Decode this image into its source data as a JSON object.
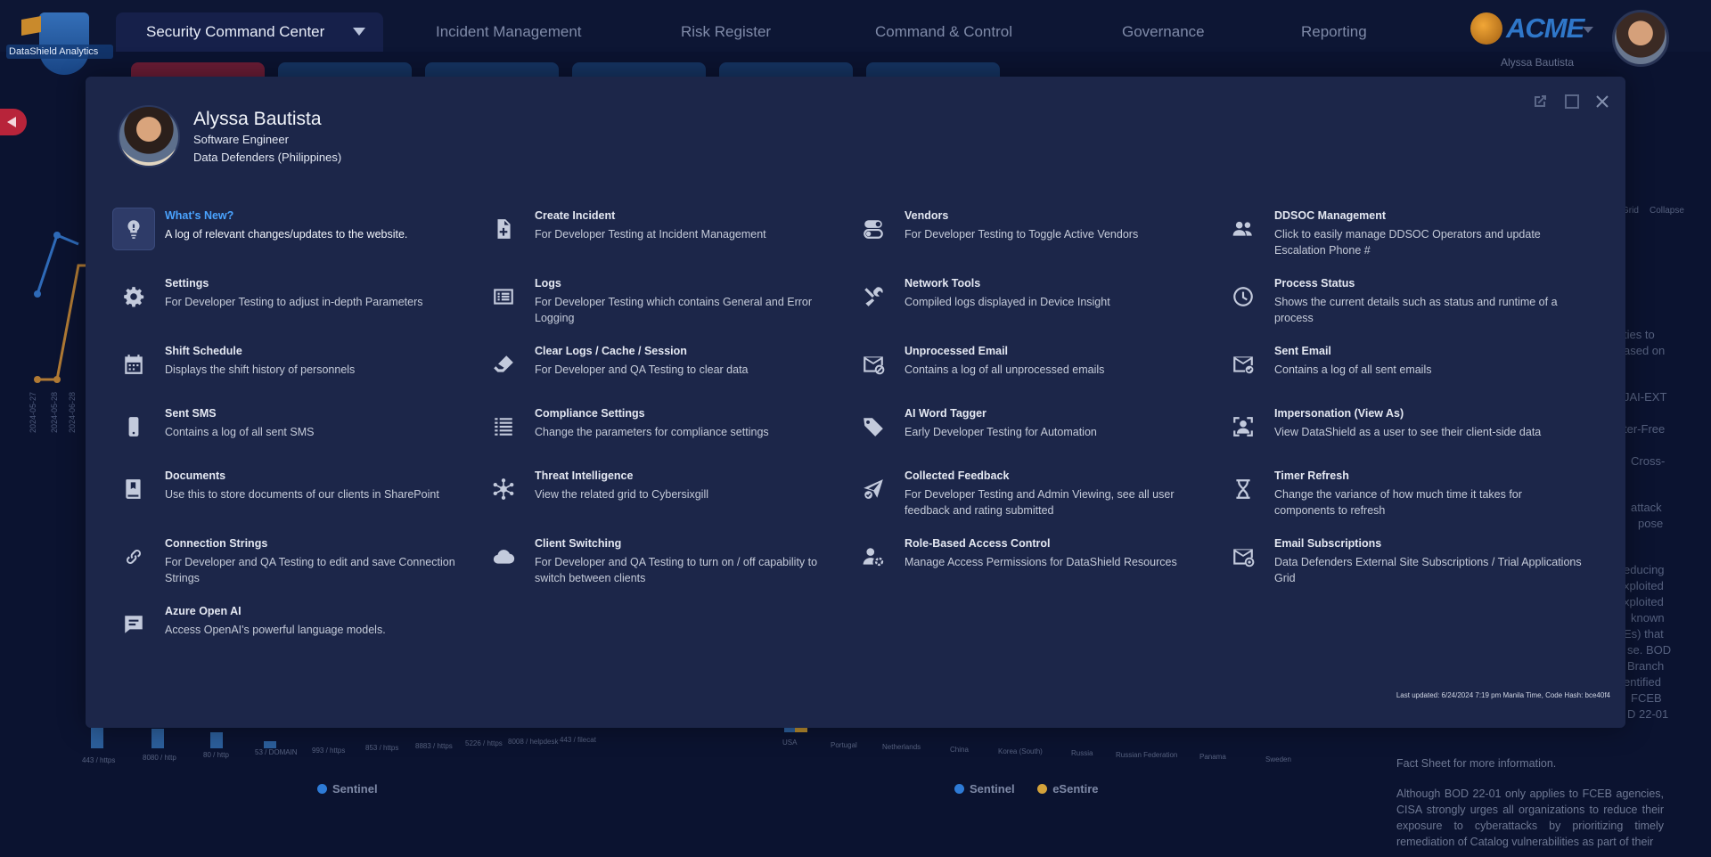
{
  "header": {
    "logo_text": "DataShield Analytics",
    "nav_active": "Security Command Center",
    "nav_items": [
      "Incident Management",
      "Risk Register",
      "Command & Control",
      "Governance",
      "Reporting"
    ],
    "brand": "ACME",
    "user_name": "Alyssa Bautista"
  },
  "background": {
    "dates": [
      "2024-05-27",
      "2024-05-28",
      "2024-06-28"
    ],
    "left_chart_categories": [
      "443 / https",
      "8080 / http",
      "80 / http",
      "53 / DOMAIN",
      "993 / https",
      "853 / https",
      "8883 / https",
      "5226 / https",
      "8008 / helpdesk",
      "443 / filecat"
    ],
    "right_chart_categories": [
      "USA",
      "Portugal",
      "Netherlands",
      "China",
      "Korea (South)",
      "Russia",
      "Russian Federation",
      "Panama",
      "Sweden"
    ],
    "legend_left": [
      "Sentinel"
    ],
    "legend_right": [
      "Sentinel",
      "eSentire"
    ],
    "colors": {
      "sentinel": "#2e7bd6",
      "esentire": "#d4a23a",
      "active_tab": "#b8243a"
    },
    "article_text": "Fact Sheet for more information.",
    "article_para": "Although BOD 22-01 only applies to FCEB agencies, CISA strongly urges all organizations to reduce their exposure to cyberattacks by prioritizing timely remediation of Catalog vulnerabilities as part of their",
    "fragments": [
      "Grid",
      "Collapse",
      "ties to",
      "ased on",
      "JAI-EXT",
      "ter-Free",
      "Cross-",
      "attack",
      "pose",
      "educing",
      "xploited",
      "xploited",
      "known",
      "Es) that",
      "se. BOD",
      "Branch",
      "entified",
      "FCEB",
      "D 22-01"
    ]
  },
  "modal": {
    "profile": {
      "name": "Alyssa Bautista",
      "role": "Software Engineer",
      "org": "Data Defenders (Philippines)"
    },
    "items": [
      {
        "title": "What's New?",
        "desc": "A log of relevant changes/updates to the website.",
        "icon": "lightbulb-icon"
      },
      {
        "title": "Create Incident",
        "desc": "For Developer Testing at Incident Management",
        "icon": "file-plus-icon"
      },
      {
        "title": "Vendors",
        "desc": "For Developer Testing to Toggle Active Vendors",
        "icon": "toggle-icon"
      },
      {
        "title": "DDSOC Management",
        "desc": "Click to easily manage DDSOC Operators and update Escalation Phone #",
        "icon": "users-icon"
      },
      {
        "title": "Settings",
        "desc": "For Developer Testing to adjust in-depth Parameters",
        "icon": "gear-icon"
      },
      {
        "title": "Logs",
        "desc": "For Developer Testing which contains General and Error Logging",
        "icon": "list-icon"
      },
      {
        "title": "Network Tools",
        "desc": "Compiled logs displayed in Device Insight",
        "icon": "tools-icon"
      },
      {
        "title": "Process Status",
        "desc": "Shows the current details such as status and runtime of a process",
        "icon": "clock-icon"
      },
      {
        "title": "Shift Schedule",
        "desc": "Displays the shift history of personnels",
        "icon": "calendar-icon"
      },
      {
        "title": "Clear Logs / Cache / Session",
        "desc": "For Developer and QA Testing to clear data",
        "icon": "eraser-icon"
      },
      {
        "title": "Unprocessed Email",
        "desc": "Contains a log of all unprocessed emails",
        "icon": "email-blocked-icon"
      },
      {
        "title": "Sent Email",
        "desc": "Contains a log of all sent emails",
        "icon": "email-sent-icon"
      },
      {
        "title": "Sent SMS",
        "desc": "Contains a log of all sent SMS",
        "icon": "phone-icon"
      },
      {
        "title": "Compliance Settings",
        "desc": "Change the parameters for compliance settings",
        "icon": "text-lines-icon"
      },
      {
        "title": "AI Word Tagger",
        "desc": "Early Developer Testing for Automation",
        "icon": "tag-icon"
      },
      {
        "title": "Impersonation (View As)",
        "desc": "View DataShield as a user to see their client-side data",
        "icon": "user-frame-icon"
      },
      {
        "title": "Documents",
        "desc": "Use this to store documents of our clients in SharePoint",
        "icon": "book-icon"
      },
      {
        "title": "Threat Intelligence",
        "desc": "View the related grid to Cybersixgill",
        "icon": "network-icon"
      },
      {
        "title": "Collected Feedback",
        "desc": "For Developer Testing and Admin Viewing, see all user feedback and rating submitted",
        "icon": "send-check-icon"
      },
      {
        "title": "Timer Refresh",
        "desc": "Change the variance of how much time it takes for components to refresh",
        "icon": "hourglass-icon"
      },
      {
        "title": "Connection Strings",
        "desc": "For Developer and QA Testing to edit and save Connection Strings",
        "icon": "link-icon"
      },
      {
        "title": "Client Switching",
        "desc": "For Developer and QA Testing to turn on / off capability to switch between clients",
        "icon": "cloud-icon"
      },
      {
        "title": "Role-Based Access Control",
        "desc": "Manage Access Permissions for DataShield Resources",
        "icon": "user-gear-icon"
      },
      {
        "title": "Email Subscriptions",
        "desc": "Data Defenders External Site Subscriptions / Trial Applications Grid",
        "icon": "email-at-icon"
      },
      {
        "title": "Azure Open AI",
        "desc": "Access OpenAI's powerful language models.",
        "icon": "chat-icon"
      }
    ],
    "last_updated": "Last updated: 6/24/2024 7:19 pm Manila Time, Code Hash: bce40f4"
  }
}
